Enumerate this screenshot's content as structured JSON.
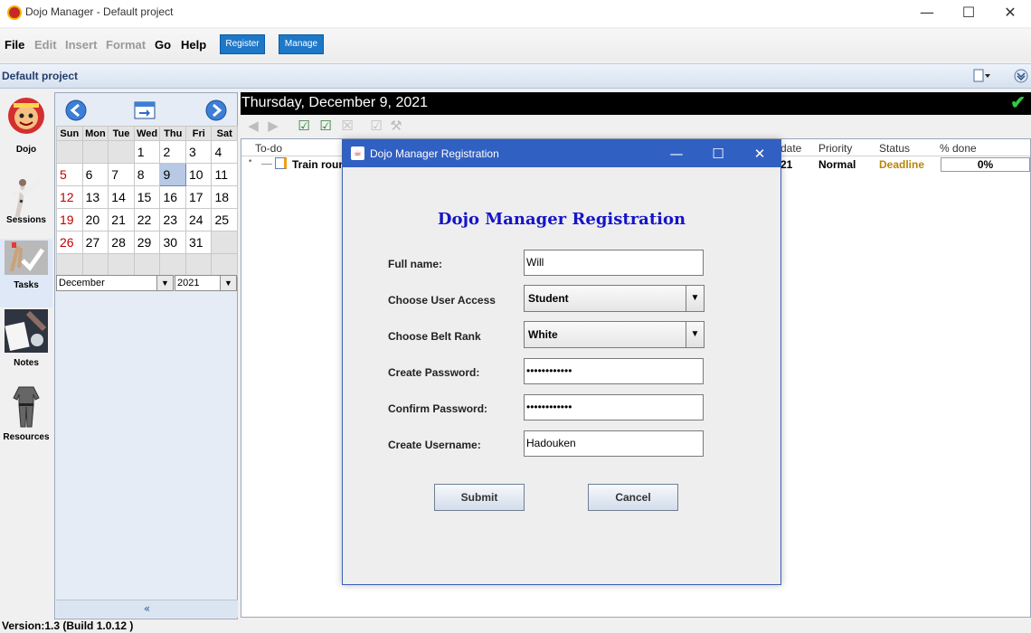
{
  "window": {
    "title": "Dojo Manager - Default project",
    "minimize": "—",
    "maximize": "☐",
    "close": "✕"
  },
  "menu": {
    "file": "File",
    "edit": "Edit",
    "insert": "Insert",
    "format": "Format",
    "go": "Go",
    "help": "Help",
    "register": "Register",
    "manage": "Manage"
  },
  "project": {
    "name": "Default project"
  },
  "nav": {
    "dojo": "Dojo",
    "sessions": "Sessions",
    "tasks": "Tasks",
    "notes": "Notes",
    "resources": "Resources"
  },
  "calendar": {
    "weekdays": [
      "Sun",
      "Mon",
      "Tue",
      "Wed",
      "Thu",
      "Fri",
      "Sat"
    ],
    "rows": [
      [
        "",
        "",
        "",
        "1",
        "2",
        "3",
        "4"
      ],
      [
        "5",
        "6",
        "7",
        "8",
        "9",
        "10",
        "11"
      ],
      [
        "12",
        "13",
        "14",
        "15",
        "16",
        "17",
        "18"
      ],
      [
        "19",
        "20",
        "21",
        "22",
        "23",
        "24",
        "25"
      ],
      [
        "26",
        "27",
        "28",
        "29",
        "30",
        "31",
        ""
      ],
      [
        "",
        "",
        "",
        "",
        "",
        "",
        ""
      ]
    ],
    "selected_day": "9",
    "month": "December",
    "year": "2021",
    "collapse": "«"
  },
  "main": {
    "date": "Thursday, December 9, 2021",
    "check": "✔",
    "columns": {
      "todo": "To-do",
      "date": "date",
      "priority": "Priority",
      "status": "Status",
      "done": "% done"
    },
    "task": {
      "name": "Train roun",
      "date": "21",
      "priority": "Normal",
      "status": "Deadline",
      "done": "0%"
    },
    "status_color": "#b8860b"
  },
  "status": {
    "version": "Version:1.3 (Build 1.0.12 )"
  },
  "dialog": {
    "title": "Dojo Manager Registration",
    "heading": "Dojo Manager Registration",
    "full_name_label": "Full name:",
    "full_name_value": "Will",
    "user_access_label": "Choose User Access",
    "user_access_value": "Student",
    "belt_rank_label": "Choose Belt Rank",
    "belt_rank_value": "White",
    "password_label": "Create Password:",
    "password_value": "••••••••••••",
    "confirm_label": "Confirm Password:",
    "confirm_value": "••••••••••••",
    "username_label": "Create Username:",
    "username_value": "Hadouken",
    "submit": "Submit",
    "cancel": "Cancel"
  }
}
